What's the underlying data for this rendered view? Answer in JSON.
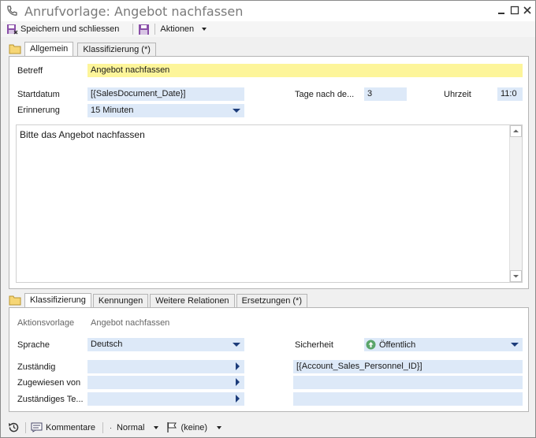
{
  "window": {
    "title": "Anrufvorlage: Angebot nachfassen"
  },
  "toolbar": {
    "save_close_label": "Speichern und schliessen",
    "actions_label": "Aktionen"
  },
  "top_tabs": [
    {
      "label": "Allgemein"
    },
    {
      "label": "Klassifizierung (*)"
    }
  ],
  "general": {
    "subject_label": "Betreff",
    "subject_value": "Angebot nachfassen",
    "startdate_label": "Startdatum",
    "startdate_value": "[{SalesDocument_Date}]",
    "days_after_label": "Tage nach de...",
    "days_after_value": "3",
    "time_label": "Uhrzeit",
    "time_value": "11:0",
    "reminder_label": "Erinnerung",
    "reminder_value": "15 Minuten",
    "body_text": "Bitte das Angebot nachfassen"
  },
  "bottom_tabs": [
    {
      "label": "Klassifizierung"
    },
    {
      "label": "Kennungen"
    },
    {
      "label": "Weitere Relationen"
    },
    {
      "label": "Ersetzungen (*)"
    }
  ],
  "classification": {
    "template_label": "Aktionsvorlage",
    "template_value": "Angebot nachfassen",
    "language_label": "Sprache",
    "language_value": "Deutsch",
    "security_label": "Sicherheit",
    "security_value": "Öffentlich",
    "responsible_label": "Zuständig",
    "responsible_value": "",
    "responsible_right_value": "[{Account_Sales_Personnel_ID}]",
    "assigned_by_label": "Zugewiesen von",
    "team_label": "Zuständiges Te..."
  },
  "statusbar": {
    "comments_label": "Kommentare",
    "priority_value": "Normal",
    "flag_value": "(keine)"
  },
  "colors": {
    "field_bg": "#dde9f8",
    "required_bg": "#fdf59a",
    "accent": "#1c3c7a"
  }
}
